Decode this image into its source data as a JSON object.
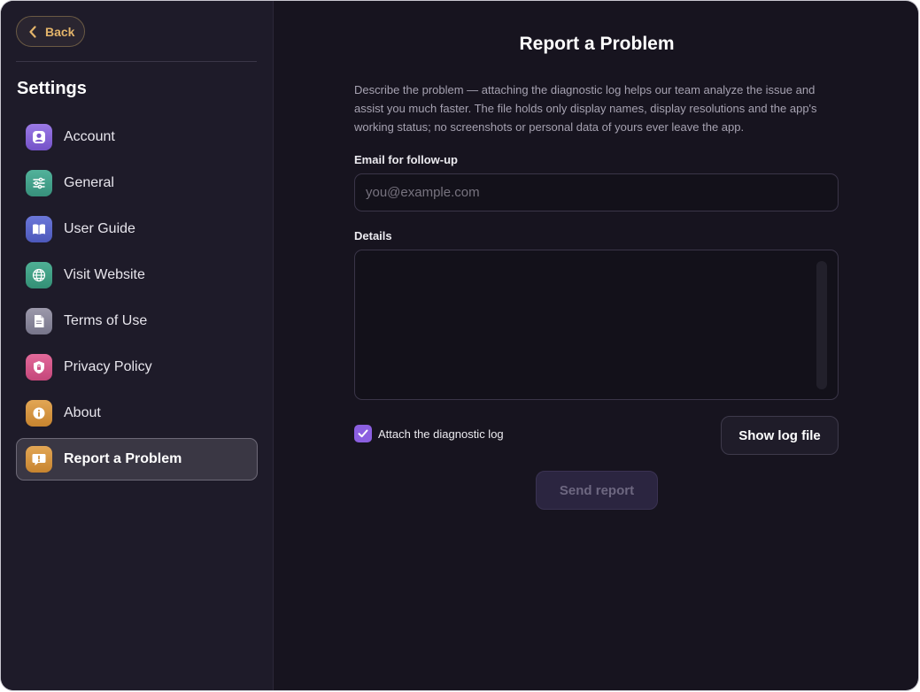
{
  "sidebar": {
    "back_label": "Back",
    "title": "Settings",
    "items": [
      {
        "label": "Account",
        "icon": "person-icon",
        "color": "#8a67d8"
      },
      {
        "label": "General",
        "icon": "sliders-icon",
        "color": "#3f9f8a"
      },
      {
        "label": "User Guide",
        "icon": "book-icon",
        "color": "#5a67c9"
      },
      {
        "label": "Visit Website",
        "icon": "globe-icon",
        "color": "#3c9f82"
      },
      {
        "label": "Terms of Use",
        "icon": "document-icon",
        "color": "#8a8799"
      },
      {
        "label": "Privacy Policy",
        "icon": "shield-icon",
        "color": "#d6578a"
      },
      {
        "label": "About",
        "icon": "info-icon",
        "color": "#d4963e"
      },
      {
        "label": "Report a Problem",
        "icon": "exclamation-bubble-icon",
        "color": "#d4963e",
        "active": true
      }
    ]
  },
  "main": {
    "title": "Report a Problem",
    "description": "Describe the problem — attaching the diagnostic log helps our team analyze the issue and assist you much faster. The file holds only display names, display resolutions and the app's working status; no screenshots or personal data of yours ever leave the app.",
    "email_label": "Email for follow-up",
    "email_placeholder": "you@example.com",
    "email_value": "",
    "details_label": "Details",
    "details_value": "",
    "attach_log_label": "Attach the diagnostic log",
    "attach_log_checked": true,
    "show_log_label": "Show log file",
    "send_label": "Send report"
  },
  "colors": {
    "accent": "#8b5fe0",
    "back_accent": "#e3b46a"
  }
}
